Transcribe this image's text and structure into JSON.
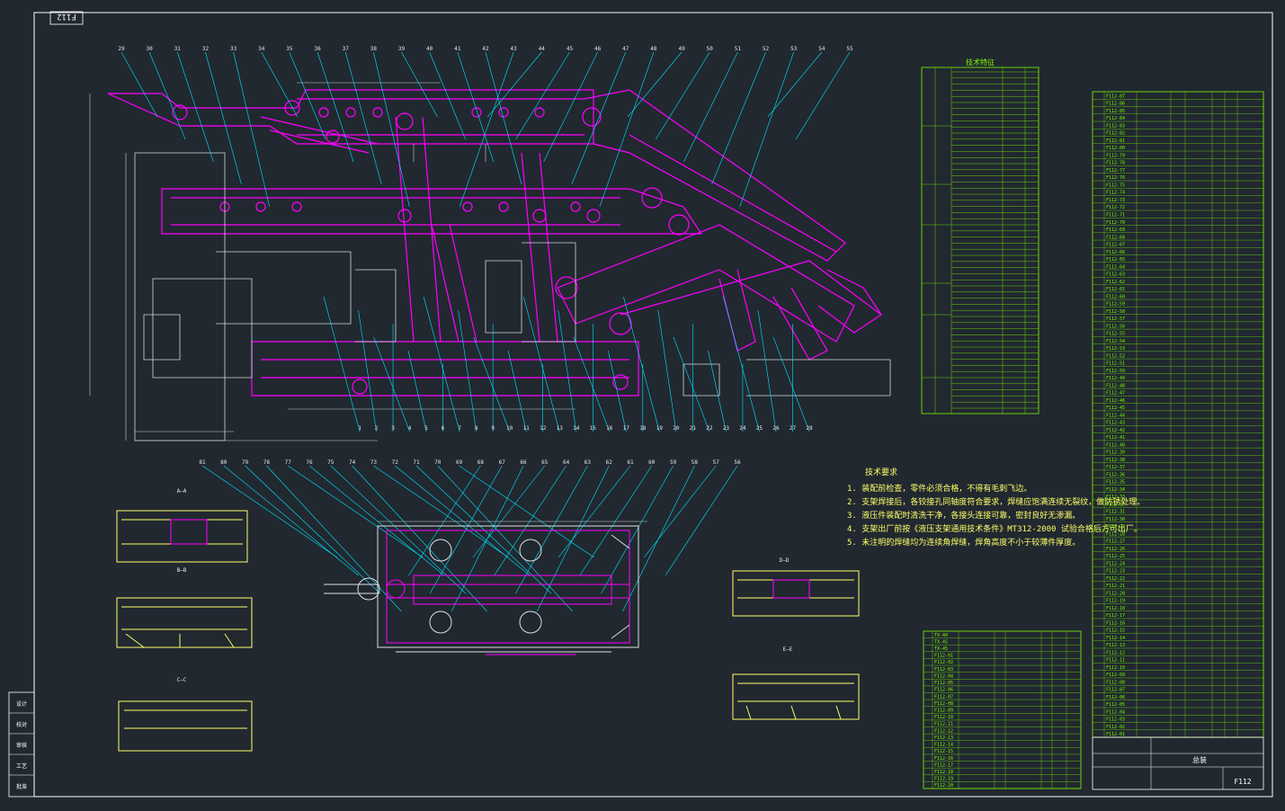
{
  "drawing": {
    "code": "F112",
    "code_mirrored": "F112",
    "title_cell": "总装"
  },
  "sections": {
    "a": "A—A",
    "b": "B—B",
    "c": "C—C",
    "d": "D—D",
    "e": "E—E"
  },
  "tech_req": {
    "heading": "技术要求",
    "lines": [
      "1. 装配前检查，零件必须合格，不得有毛刺飞边。",
      "2. 支架焊接后，各铰接孔同轴度符合要求，焊缝应饱满连续无裂纹，做防锈处理。",
      "3. 液压件装配时清洗干净，各接头连接可靠，密封良好无渗漏。",
      "4. 支架出厂前按《液压支架通用技术条件》MT312-2000 试验合格后方可出厂。",
      "5. 未注明的焊缝均为连续角焊缝，焊角高度不小于较薄件厚度。"
    ]
  },
  "tech_table_title": "技术特征",
  "legend": {
    "rows": [
      {
        "label": "设计"
      },
      {
        "label": "校对"
      },
      {
        "label": "审核"
      },
      {
        "label": "工艺"
      },
      {
        "label": "批准"
      }
    ]
  },
  "callouts_top": [
    "29",
    "30",
    "31",
    "32",
    "33",
    "34",
    "35",
    "36",
    "37",
    "38",
    "39",
    "40",
    "41",
    "42",
    "43",
    "44",
    "45",
    "46",
    "47",
    "48",
    "49",
    "50",
    "51",
    "52",
    "53",
    "54",
    "55"
  ],
  "callouts_bottom": [
    "81",
    "80",
    "79",
    "78",
    "77",
    "76",
    "75",
    "74",
    "73",
    "72",
    "71",
    "70",
    "69",
    "68",
    "67",
    "66",
    "65",
    "64",
    "63",
    "62",
    "61",
    "60",
    "59",
    "58",
    "57",
    "56"
  ],
  "callouts_mid": [
    "1",
    "2",
    "3",
    "4",
    "5",
    "6",
    "7",
    "8",
    "9",
    "10",
    "11",
    "12",
    "13",
    "14",
    "15",
    "16",
    "17",
    "18",
    "19",
    "20",
    "21",
    "22",
    "23",
    "24",
    "25",
    "26",
    "27",
    "28"
  ],
  "bom_right_codes": [
    "F112-87",
    "F112-86",
    "F112-85",
    "F112-84",
    "F112-83",
    "F112-82",
    "F112-81",
    "F112-80",
    "F112-79",
    "F112-78",
    "F112-77",
    "F112-76",
    "F112-75",
    "F112-74",
    "F112-73",
    "F112-72",
    "F112-71",
    "F112-70",
    "F112-69",
    "F112-68",
    "F112-67",
    "F112-66",
    "F112-65",
    "F112-64",
    "F112-63",
    "F112-62",
    "F112-61",
    "F112-60",
    "F112-59",
    "F112-58",
    "F112-57",
    "F112-56",
    "F112-55",
    "F112-54",
    "F112-53",
    "F112-52",
    "F112-51",
    "F112-50",
    "F112-49",
    "F112-48",
    "F112-47",
    "F112-46",
    "F112-45",
    "F112-44",
    "F112-43",
    "F112-42",
    "F112-41",
    "F112-40",
    "F112-39",
    "F112-38",
    "F112-37",
    "F112-36",
    "F112-35",
    "F112-34",
    "F112-33",
    "F112-32",
    "F112-31",
    "F112-30",
    "F112-29",
    "F112-28",
    "F112-27",
    "F112-26",
    "F112-25",
    "F112-24",
    "F112-23",
    "F112-22",
    "F112-21",
    "F112-20",
    "F112-19",
    "F112-18",
    "F112-17",
    "F112-16",
    "F112-15",
    "F112-14",
    "F112-13",
    "F112-12",
    "F112-11",
    "F112-10",
    "F112-09",
    "F112-08",
    "F112-07",
    "F112-06",
    "F112-05",
    "F112-04",
    "F112-03",
    "F112-02",
    "F112-01"
  ],
  "bom_mid_codes": [
    "TX-40",
    "TX-45",
    "TX-45",
    "F112-01",
    "F112-02",
    "F112-03",
    "F112-04",
    "F112-05",
    "F112-06",
    "F112-07",
    "F112-08",
    "F112-09",
    "F112-10",
    "F112-11",
    "F112-12",
    "F112-13",
    "F112-14",
    "F112-15",
    "F112-16",
    "F112-17",
    "F112-18",
    "F112-19",
    "F112-20"
  ],
  "colors": {
    "background": "#212830",
    "border": "#ffffff",
    "structure": "#ff00ff",
    "leaders": "#00e5ff",
    "tables": "#7CFC00",
    "sections": "#ffff66"
  }
}
